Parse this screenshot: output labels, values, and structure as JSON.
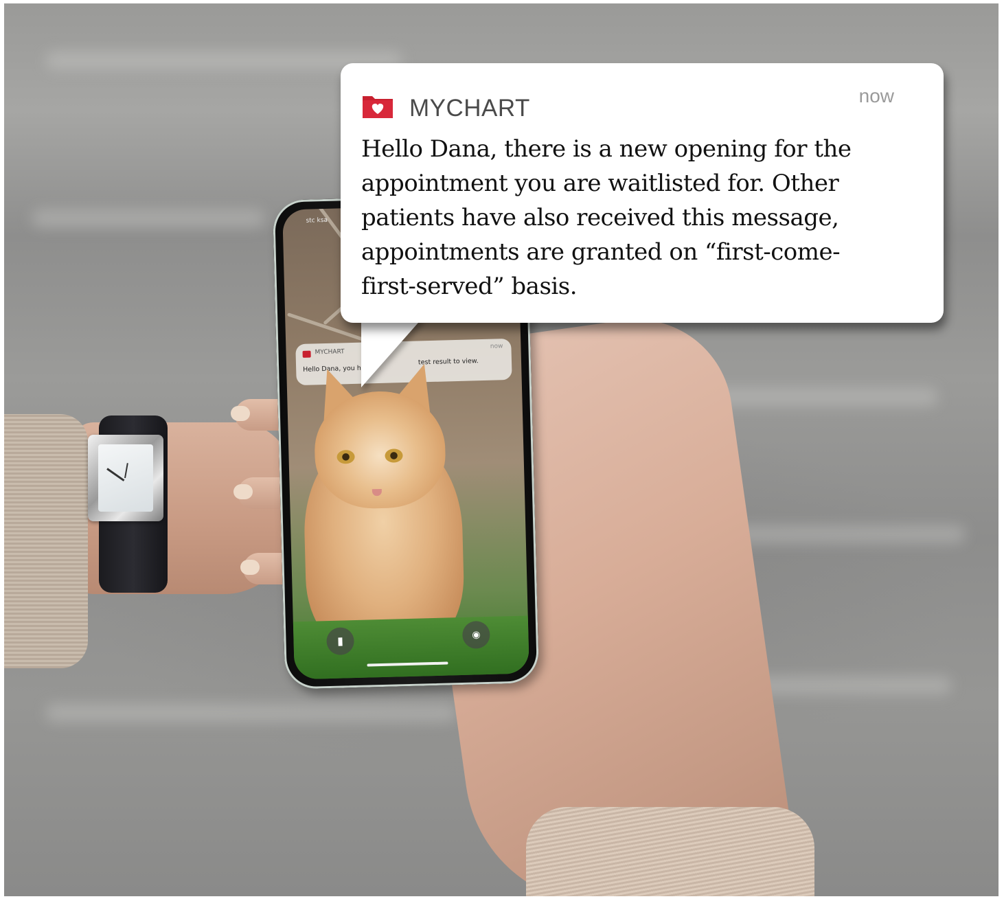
{
  "notification": {
    "app_name": "MYCHART",
    "time": "now",
    "message": " Hello Dana, there is a new opening for the\nappointment you are waitlisted for. Other\npatients have also received this message,\nappointments are granted on “first-come-\nfirst-served” basis.",
    "icon": "mychart-folder-heart-icon"
  },
  "phone_screen": {
    "carrier": "stc ksa",
    "mini_notification": {
      "app_name": "MYCHART",
      "time": "now",
      "message_start": "Hello Dana, you h",
      "message_end": "test result to view."
    },
    "flashlight_icon": "flashlight-icon",
    "camera_icon": "camera-icon"
  },
  "colors": {
    "brand_red": "#c8202f",
    "bubble_bg": "#ffffff",
    "text_dark": "#111111",
    "text_muted": "#9a9a9a"
  }
}
